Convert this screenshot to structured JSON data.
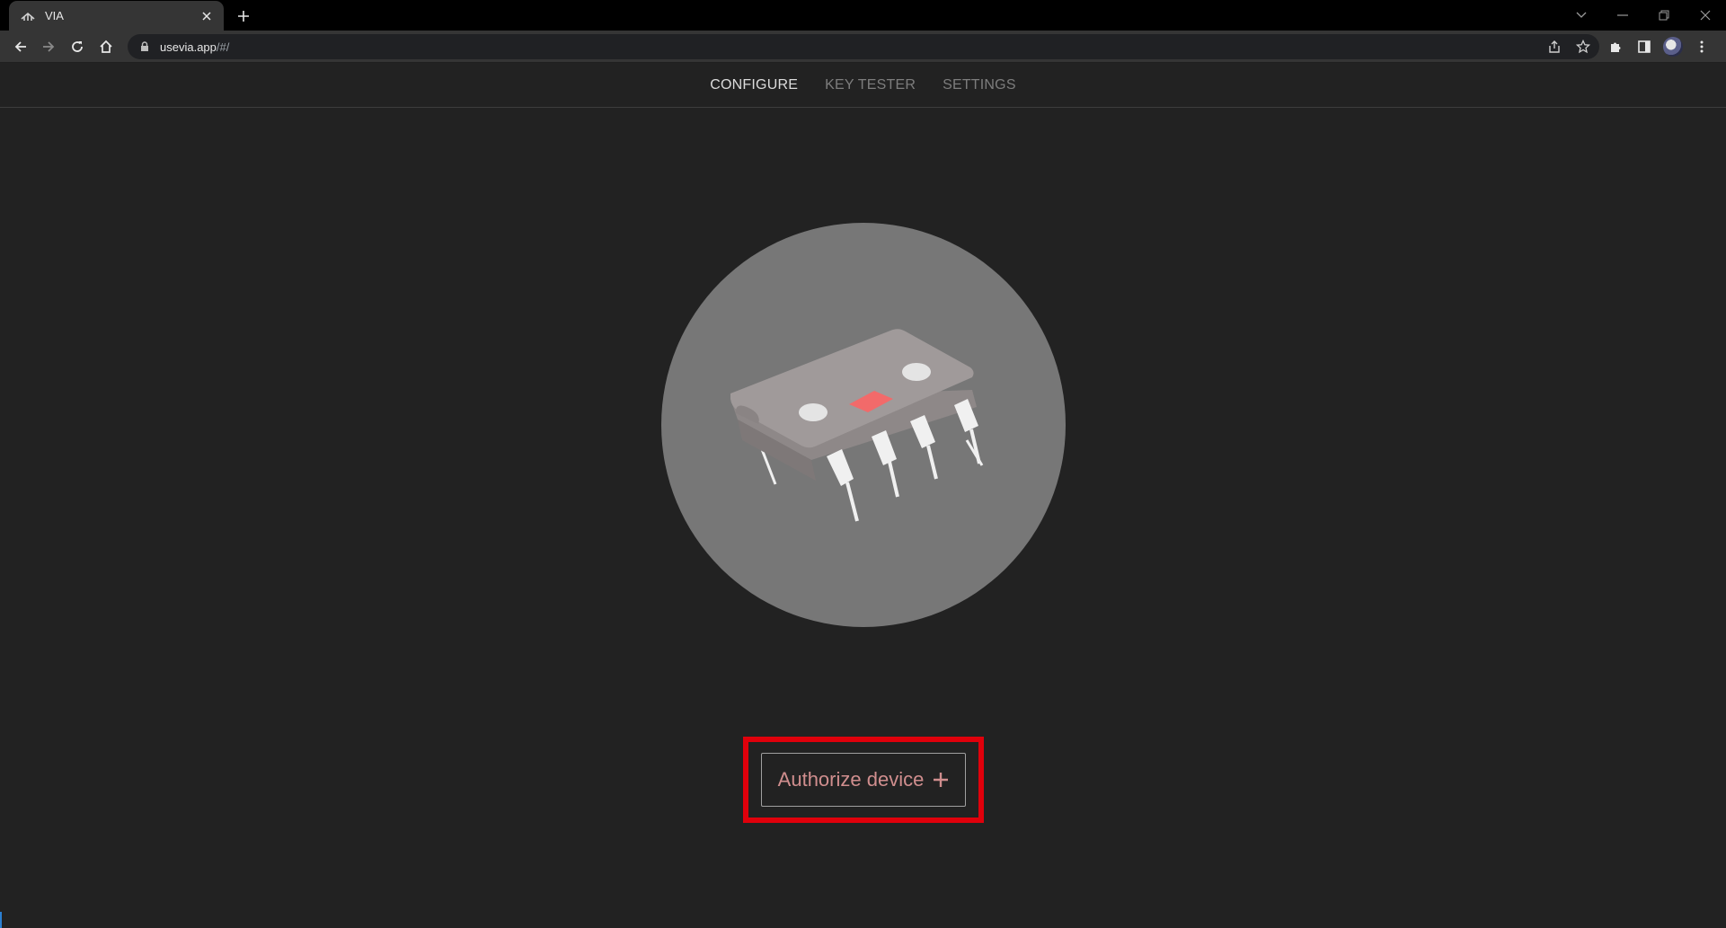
{
  "browser": {
    "tab_title": "VIA",
    "url_host": "usevia.app",
    "url_path": "/#/"
  },
  "nav": {
    "items": [
      {
        "label": "CONFIGURE",
        "active": true
      },
      {
        "label": "KEY TESTER",
        "active": false
      },
      {
        "label": "SETTINGS",
        "active": false
      }
    ]
  },
  "main": {
    "illustration": "chip-icon",
    "authorize_label": "Authorize device",
    "authorize_icon": "plus-icon"
  },
  "colors": {
    "background": "#222222",
    "accent_text": "#d08e8e",
    "highlight": "#e0000b",
    "chip_led": "#f26a6a"
  }
}
